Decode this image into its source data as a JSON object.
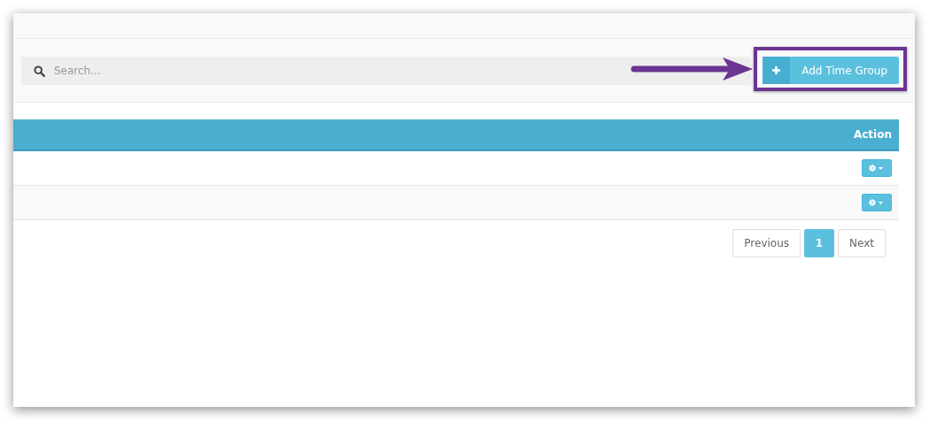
{
  "search": {
    "placeholder": "Search..."
  },
  "add_button": {
    "label": "Add Time Group"
  },
  "callout": {
    "arrow": true,
    "highlight_box": true
  },
  "table": {
    "columns": [
      {
        "label": "Action"
      }
    ],
    "rows": [
      {
        "kind": "gear-dropdown"
      },
      {
        "kind": "gear-dropdown"
      }
    ]
  },
  "pagination": {
    "previous": "Previous",
    "pages": [
      {
        "label": "1",
        "selected": true
      }
    ],
    "next": "Next"
  }
}
